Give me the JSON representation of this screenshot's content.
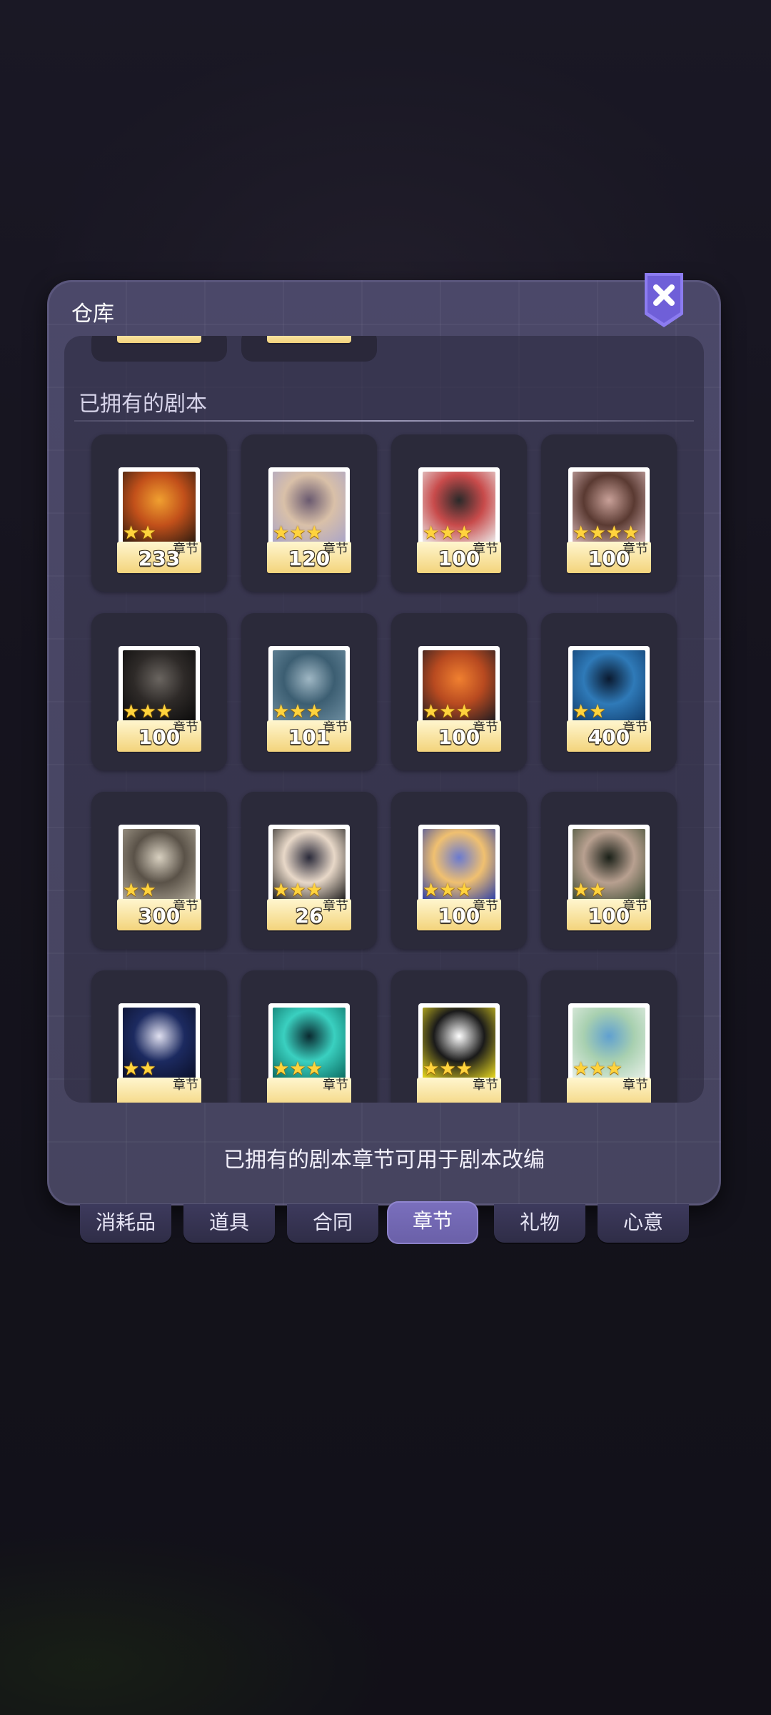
{
  "panel": {
    "title": "仓库",
    "section_title": "已拥有的剧本",
    "footer_note": "已拥有的剧本章节可用于剧本改编"
  },
  "chapter_tag": "章节",
  "star_glyph": "★",
  "items": [
    {
      "count": "233",
      "stars": 2,
      "art": [
        "#2a1a10",
        "#c2501a",
        "#f0a030"
      ]
    },
    {
      "count": "120",
      "stars": 3,
      "art": [
        "#a9a4c8",
        "#d9c0a8",
        "#6a5a70"
      ]
    },
    {
      "count": "100",
      "stars": 3,
      "art": [
        "#ececec",
        "#c84b4b",
        "#2a2a2a"
      ]
    },
    {
      "count": "100",
      "stars": 4,
      "art": [
        "#d9b8b8",
        "#5a3a32",
        "#c8a098"
      ]
    },
    {
      "count": "100",
      "stars": 3,
      "art": [
        "#0a0a0a",
        "#2e2a28",
        "#6a6560"
      ]
    },
    {
      "count": "101",
      "stars": 3,
      "art": [
        "#6d8da0",
        "#3c5e72",
        "#9fb7c4"
      ]
    },
    {
      "count": "100",
      "stars": 3,
      "art": [
        "#1a1a22",
        "#b84a20",
        "#f08030"
      ]
    },
    {
      "count": "400",
      "stars": 2,
      "art": [
        "#0f3a6a",
        "#2f7ab8",
        "#0a1a30"
      ]
    },
    {
      "count": "300",
      "stars": 2,
      "art": [
        "#b0a898",
        "#5a5248",
        "#d8d0c0"
      ]
    },
    {
      "count": "26",
      "stars": 3,
      "art": [
        "#1a1a1a",
        "#e8d8c8",
        "#2a2a3a"
      ]
    },
    {
      "count": "100",
      "stars": 3,
      "art": [
        "#2a3ea8",
        "#f0c070",
        "#6a7ad0"
      ]
    },
    {
      "count": "100",
      "stars": 2,
      "art": [
        "#3a4a30",
        "#b8a090",
        "#1a2018"
      ]
    },
    {
      "count": "",
      "stars": 2,
      "art": [
        "#0a0f28",
        "#1c2a60",
        "#e0e0f0"
      ]
    },
    {
      "count": "",
      "stars": 3,
      "art": [
        "#0a6a60",
        "#3ad0c0",
        "#0a2a30"
      ]
    },
    {
      "count": "",
      "stars": 3,
      "art": [
        "#f0e020",
        "#1a1a1a",
        "#ffffff"
      ]
    },
    {
      "count": "",
      "stars": 3,
      "art": [
        "#e8f0e8",
        "#a8d0b0",
        "#60a0d0"
      ]
    }
  ],
  "tabs": [
    {
      "label": "消耗品",
      "active": false
    },
    {
      "label": "道具",
      "active": false
    },
    {
      "label": "合同",
      "active": false
    },
    {
      "label": "章节",
      "active": true
    },
    {
      "label": "礼物",
      "active": false
    },
    {
      "label": "心意",
      "active": false
    }
  ]
}
